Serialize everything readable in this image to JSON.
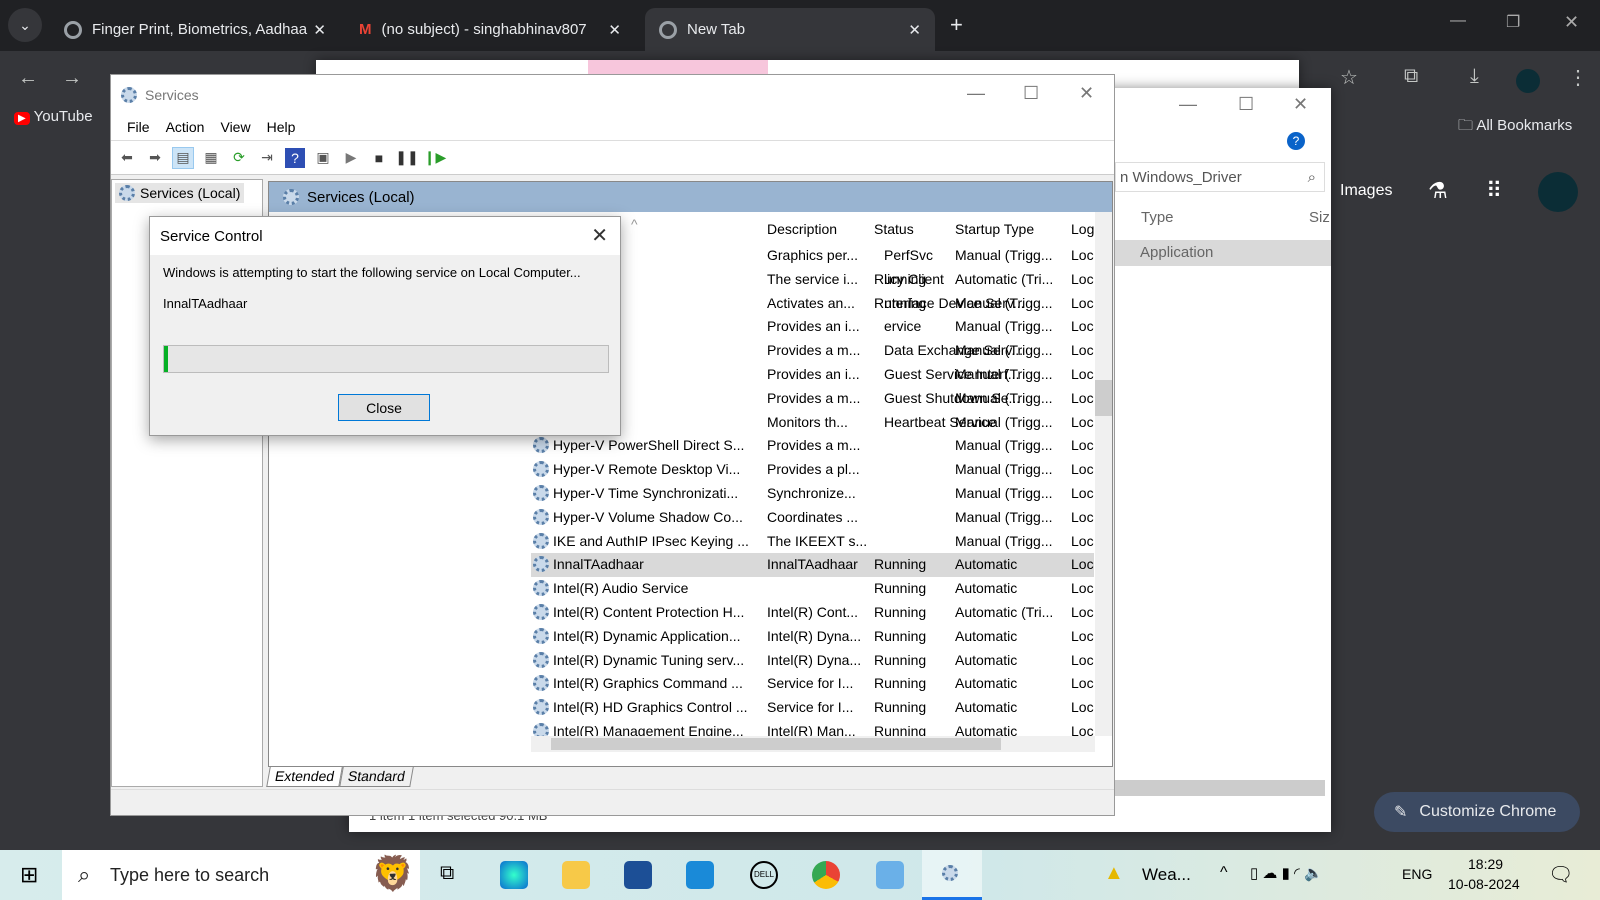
{
  "browser": {
    "tabs": [
      {
        "label": "Finger Print, Biometrics, Aadhaa"
      },
      {
        "label": "(no subject) - singhabhinav807"
      },
      {
        "label": "New Tab"
      }
    ],
    "bookmarks": [
      {
        "label": "YouTube"
      }
    ],
    "all_bookmarks": "All Bookmarks",
    "images_link": "Images",
    "customize": "Customize Chrome"
  },
  "explorer": {
    "search": "n Windows_Driver",
    "col_type": "Type",
    "col_size": "Siz",
    "row_type": "Application",
    "status": "1 item    1 item selected  90.1 MB"
  },
  "services": {
    "title": "Services",
    "menu": [
      "File",
      "Action",
      "View",
      "Help"
    ],
    "tree_item": "Services (Local)",
    "pane_header": "Services (Local)",
    "columns": [
      "Description",
      "Status",
      "Startup Type",
      "Log"
    ],
    "rows": [
      [
        "PerfSvc",
        "Graphics per...",
        "",
        "Manual (Trigg...",
        "Loc"
      ],
      [
        "licy Client",
        "The service i...",
        "Running",
        "Automatic (Tri...",
        "Loc"
      ],
      [
        "nterface Device Serv...",
        "Activates an...",
        "Running",
        "Manual (Trigg...",
        "Loc"
      ],
      [
        "ervice",
        "Provides an i...",
        "",
        "Manual (Trigg...",
        "Loc"
      ],
      [
        "Data Exchange Serv...",
        "Provides a m...",
        "",
        "Manual (Trigg...",
        "Loc"
      ],
      [
        "Guest Service Interf...",
        "Provides an i...",
        "",
        "Manual (Trigg...",
        "Loc"
      ],
      [
        "Guest Shutdown Se...",
        "Provides a m...",
        "",
        "Manual (Trigg...",
        "Loc"
      ],
      [
        "Heartbeat Service",
        "Monitors th...",
        "",
        "Manual (Trigg...",
        "Loc"
      ],
      [
        "Hyper-V PowerShell Direct S...",
        "Provides a m...",
        "",
        "Manual (Trigg...",
        "Loc"
      ],
      [
        "Hyper-V Remote Desktop Vi...",
        "Provides a pl...",
        "",
        "Manual (Trigg...",
        "Loc"
      ],
      [
        "Hyper-V Time Synchronizati...",
        "Synchronize...",
        "",
        "Manual (Trigg...",
        "Loc"
      ],
      [
        "Hyper-V Volume Shadow Co...",
        "Coordinates ...",
        "",
        "Manual (Trigg...",
        "Loc"
      ],
      [
        "IKE and AuthIP IPsec Keying ...",
        "The IKEEXT s...",
        "",
        "Manual (Trigg...",
        "Loc"
      ],
      [
        "InnalTAadhaar",
        "InnalTAadhaar",
        "Running",
        "Automatic",
        "Loc"
      ],
      [
        "Intel(R) Audio Service",
        "",
        "Running",
        "Automatic",
        "Loc"
      ],
      [
        "Intel(R) Content Protection H...",
        "Intel(R) Cont...",
        "Running",
        "Automatic (Tri...",
        "Loc"
      ],
      [
        "Intel(R) Dynamic Application...",
        "Intel(R) Dyna...",
        "Running",
        "Automatic",
        "Loc"
      ],
      [
        "Intel(R) Dynamic Tuning serv...",
        "Intel(R) Dyna...",
        "Running",
        "Automatic",
        "Loc"
      ],
      [
        "Intel(R) Graphics Command ...",
        "Service for I...",
        "Running",
        "Automatic",
        "Loc"
      ],
      [
        "Intel(R) HD Graphics Control ...",
        "Service for I...",
        "Running",
        "Automatic",
        "Loc"
      ],
      [
        "Intel(R) Management Engine...",
        "Intel(R) Man...",
        "Running",
        "Automatic",
        "Loc"
      ]
    ],
    "selected_row": 13,
    "hidden_rows": 8,
    "view_tabs": [
      "Extended",
      "Standard"
    ]
  },
  "dialog": {
    "title": "Service Control",
    "message": "Windows is attempting to start the following service on Local Computer...",
    "service": "InnalTAadhaar",
    "progress_percent": 1,
    "close": "Close"
  },
  "taskbar": {
    "search_placeholder": "Type here to search",
    "weather": "Wea...",
    "lang": "ENG",
    "time": "18:29",
    "date": "10-08-2024"
  }
}
